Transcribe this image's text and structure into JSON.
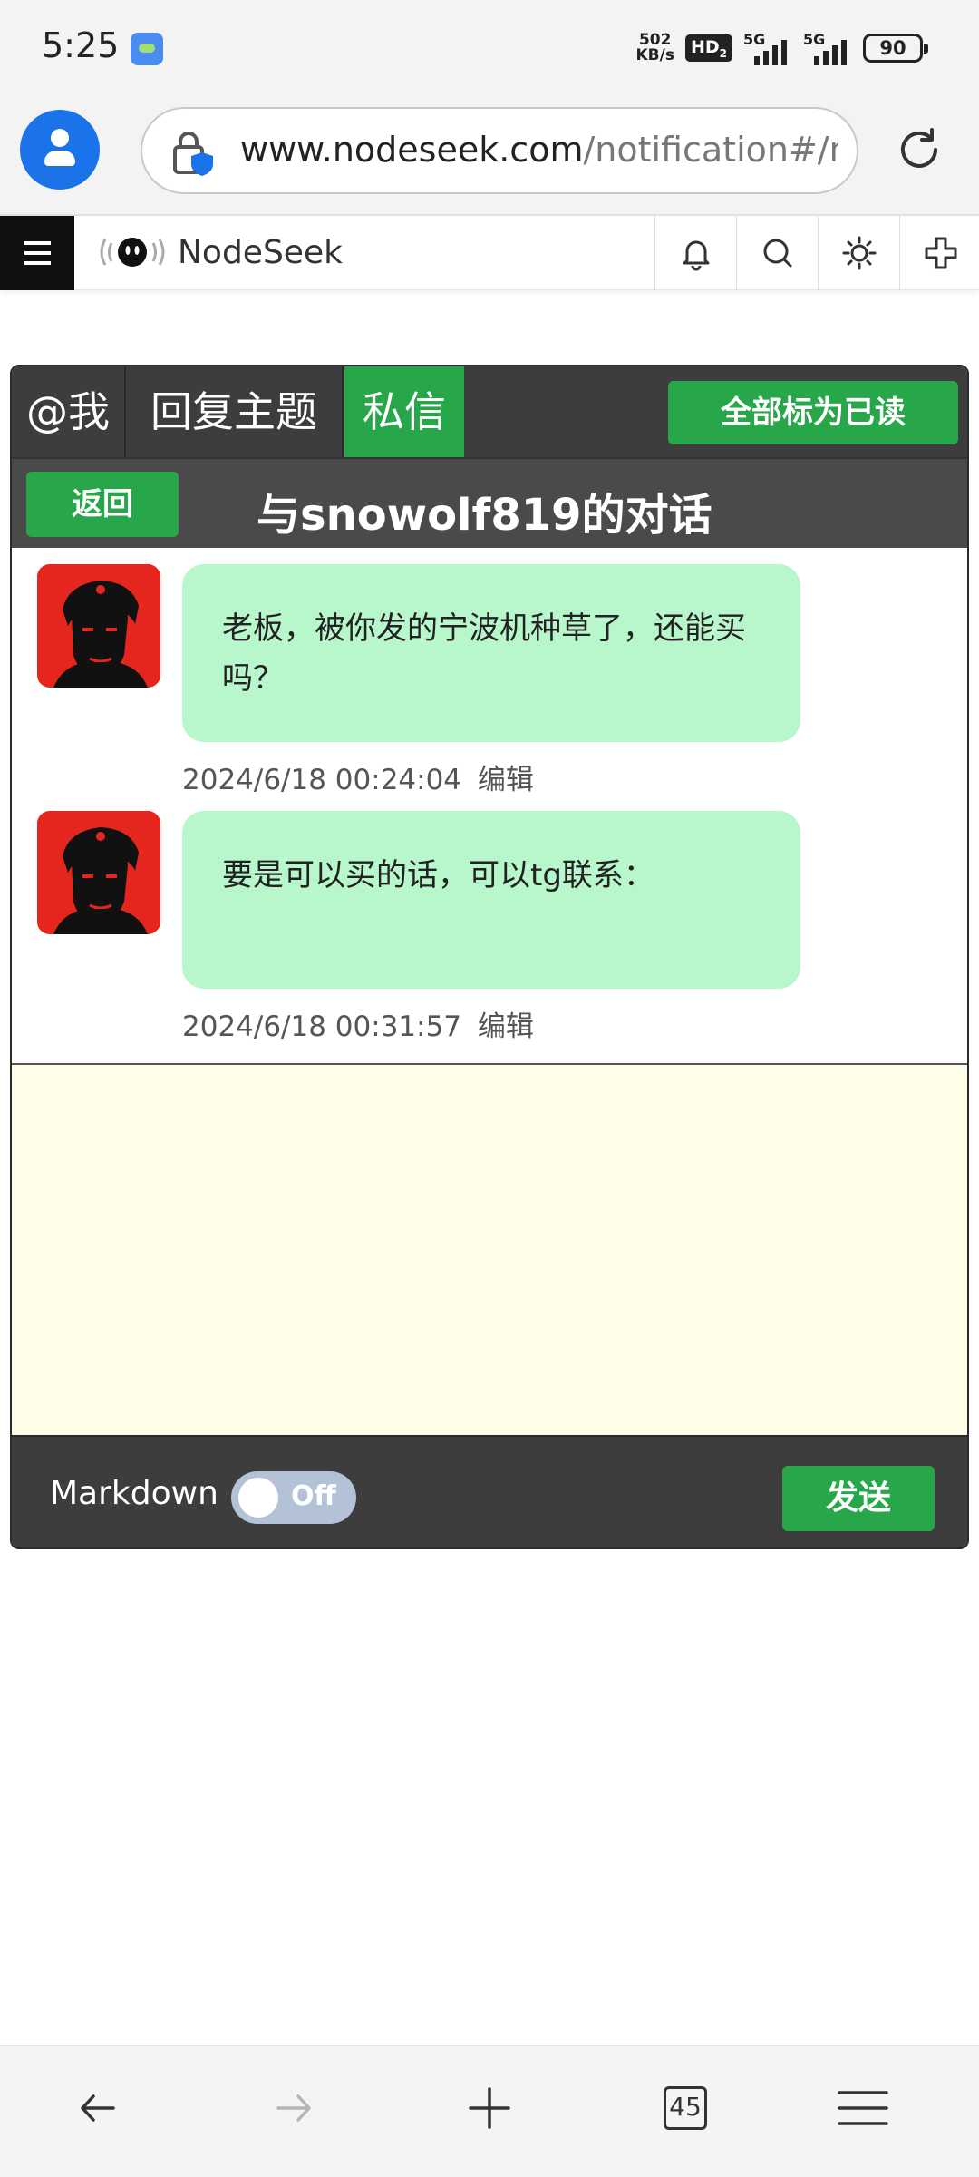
{
  "status_bar": {
    "time": "5:25",
    "net_speed_value": "502",
    "net_speed_unit": "KB/s",
    "hd_label": "HD",
    "hd_sub": "2",
    "signal1_label": "5G",
    "signal2_label": "5G",
    "battery_level": "90"
  },
  "browser": {
    "url_host": "www.nodeseek.com",
    "url_path": "/notification#/m",
    "account_icon": "account-icon",
    "lock_icon": "shield-lock-icon",
    "reload_icon": "reload-icon"
  },
  "site_header": {
    "brand_name": "NodeSeek",
    "icons": [
      "bell-icon",
      "search-icon",
      "theme-sun-icon",
      "add-icon"
    ]
  },
  "tabs": {
    "at_me": "@我",
    "reply_topic": "回复主题",
    "private_msg": "私信",
    "active": "私信"
  },
  "mark_all_read_label": "全部标为已读",
  "conversation": {
    "back_label": "返回",
    "title": "与snowolf819的对话"
  },
  "messages": [
    {
      "text": "老板，被你发的宁波机种草了，还能买吗？",
      "timestamp": "2024/6/18 00:24:04",
      "edit_label": "编辑"
    },
    {
      "text": "要是可以买的话，可以tg联系：",
      "timestamp": "2024/6/18 00:31:57",
      "edit_label": "编辑"
    }
  ],
  "composer": {
    "markdown_label": "Markdown",
    "toggle_state": "Off",
    "send_label": "发送"
  },
  "bottom_nav": {
    "tab_count": "45",
    "icons": [
      "back-arrow-icon",
      "forward-arrow-icon",
      "new-tab-icon",
      "tabs-icon",
      "menu-icon"
    ]
  },
  "colors": {
    "accent_green": "#27a74a",
    "bubble_green": "#b8f7cc",
    "dark_bar": "#3d3d3d",
    "editor_bg": "#fefee8",
    "browser_blue": "#1a73e8"
  }
}
